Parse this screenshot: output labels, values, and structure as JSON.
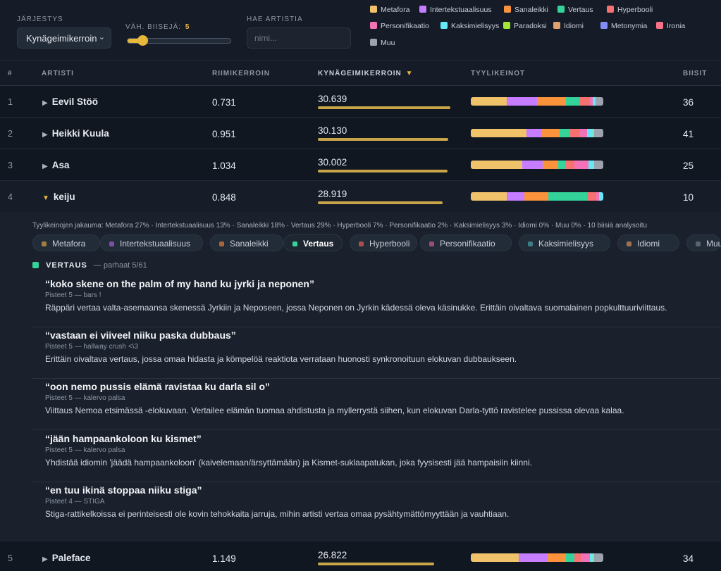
{
  "controls": {
    "sort_label": "JÄRJESTYS",
    "sort_value": "Kynägeimikerroin",
    "min_songs_label": "VÄH. BIISEJÄ:",
    "min_songs_value": "5",
    "min_songs_fraction": 0.1,
    "search_label": "HAE ARTISTIA",
    "search_placeholder": "nimi...",
    "search_value": ""
  },
  "legend": [
    {
      "label": "Metafora",
      "color": "#f0c36b"
    },
    {
      "label": "Intertekstuaalisuus",
      "color": "#c77dff"
    },
    {
      "label": "Sanaleikki",
      "color": "#fb923c"
    },
    {
      "label": "Vertaus",
      "color": "#34d399"
    },
    {
      "label": "Hyperbooli",
      "color": "#f87171"
    },
    {
      "label": "Personifikaatio",
      "color": "#f472b6"
    },
    {
      "label": "Kaksimielisyys",
      "color": "#67e8f9"
    },
    {
      "label": "Paradoksi",
      "color": "#a3e635"
    },
    {
      "label": "Idiomi",
      "color": "#e0a070"
    },
    {
      "label": "Metonymia",
      "color": "#818cf8"
    },
    {
      "label": "Ironia",
      "color": "#fb7185"
    },
    {
      "label": "Muu",
      "color": "#9ca3af"
    }
  ],
  "table": {
    "headers": {
      "rank": "#",
      "artist": "ARTISTI",
      "rhyme": "RIIMIKERROIN",
      "pen": "KYNÄGEIMIKERROIN",
      "sort_marker": "▼",
      "styles": "TYYLIKEINOT",
      "songs": "BIISIT"
    },
    "rows": [
      {
        "rank": "1",
        "artist": "Eevil Stöö",
        "rhyme": "0.731",
        "pen": "30.639",
        "songs": "36",
        "expanded": false,
        "styles": [
          27,
          23,
          22,
          10,
          8,
          2,
          2,
          0,
          0,
          0,
          0,
          6
        ]
      },
      {
        "rank": "2",
        "artist": "Heikki Kuula",
        "rhyme": "0.951",
        "pen": "30.130",
        "songs": "41",
        "expanded": false,
        "styles": [
          42,
          11,
          14,
          8,
          7,
          6,
          4,
          1,
          0,
          0,
          0,
          7
        ]
      },
      {
        "rank": "3",
        "artist": "Asa",
        "rhyme": "1.034",
        "pen": "30.002",
        "songs": "25",
        "expanded": false,
        "styles": [
          39,
          15,
          12,
          6,
          6,
          11,
          4,
          0,
          0,
          0,
          0,
          7
        ]
      },
      {
        "rank": "4",
        "artist": "keiju",
        "rhyme": "0.848",
        "pen": "28.919",
        "songs": "10",
        "expanded": true,
        "styles": [
          27,
          13,
          18,
          29,
          7,
          2,
          3,
          0,
          0,
          0,
          0,
          0
        ]
      },
      {
        "rank": "5",
        "artist": "Paleface",
        "rhyme": "1.149",
        "pen": "26.822",
        "songs": "34",
        "expanded": false,
        "styles": [
          36,
          22,
          14,
          6,
          5,
          7,
          2,
          1,
          0,
          0,
          0,
          7
        ]
      }
    ]
  },
  "detail": {
    "distribution_text": "Tyylikeinojen jakauma: Metafora 27% · Intertekstuaalisuus 13% · Sanaleikki 18% · Vertaus 29% · Hyperbooli 7% · Personifikaatio 2% · Kaksimielisyys 3% · Idiomi 0% · Muu 0%  ·  10 biisiä analysoitu",
    "chips": [
      {
        "label": "Metafora",
        "color": "#a07f3e",
        "active": false
      },
      {
        "label": "Intertekstuaalisuus",
        "color": "#7d4fa8",
        "active": false
      },
      {
        "label": "Sanaleikki",
        "color": "#a8653a",
        "active": false
      },
      {
        "label": "Vertaus",
        "color": "#34d399",
        "active": true
      },
      {
        "label": "Hyperbooli",
        "color": "#a64f4f",
        "active": false
      },
      {
        "label": "Personifikaatio",
        "color": "#9c4a76",
        "active": false
      },
      {
        "label": "Kaksimielisyys",
        "color": "#3e7d86",
        "active": false
      },
      {
        "label": "Idiomi",
        "color": "#a07050",
        "active": false
      },
      {
        "label": "Muu",
        "color": "#5c6270",
        "active": false
      }
    ],
    "section_title": "VERTAUS",
    "section_sub": "— parhaat 5/61",
    "quotes": [
      {
        "text": "“koko skene on the palm of my hand ku jyrki ja neponen”",
        "meta": "Pisteet 5   — bars !",
        "explanation": "Räppäri vertaa valta-asemaansa skenessä Jyrkiin ja Neposeen, jossa Neponen on Jyrkin kädessä oleva käsinukke. Erittäin oivaltava suomalainen popkulttuuriviittaus."
      },
      {
        "text": "“vastaan ei viiveel niiku paska dubbaus”",
        "meta": "Pisteet 5   — hallway crush <\\3",
        "explanation": "Erittäin oivaltava vertaus, jossa omaa hidasta ja kömpelöä reaktiota verrataan huonosti synkronoituun elokuvan dubbaukseen."
      },
      {
        "text": "“oon nemo pussis elämä ravistaa ku darla sil o”",
        "meta": "Pisteet 5   — kalervo palsa",
        "explanation": "Viittaus Nemoa etsimässä -elokuvaan. Vertailee elämän tuomaa ahdistusta ja myllerrystä siihen, kun elokuvan Darla-tyttö ravistelee pussissa olevaa kalaa."
      },
      {
        "text": "“jään hampaankoloon ku kismet”",
        "meta": "Pisteet 5   — kalervo palsa",
        "explanation": "Yhdistää idiomin 'jäädä hampaankoloon' (kaivelemaan/ärsyttämään) ja Kismet-suklaapatukan, joka fyysisesti jää hampaisiin kiinni."
      },
      {
        "text": "“en tuu ikinä stoppaa niiku stiga”",
        "meta": "Pisteet 4   — STIGA",
        "explanation": "Stiga-rattikelkoissa ei perinteisesti ole kovin tehokkaita jarruja, mihin artisti vertaa omaa pysähtymättömyyttään ja vauhtiaan."
      }
    ]
  }
}
